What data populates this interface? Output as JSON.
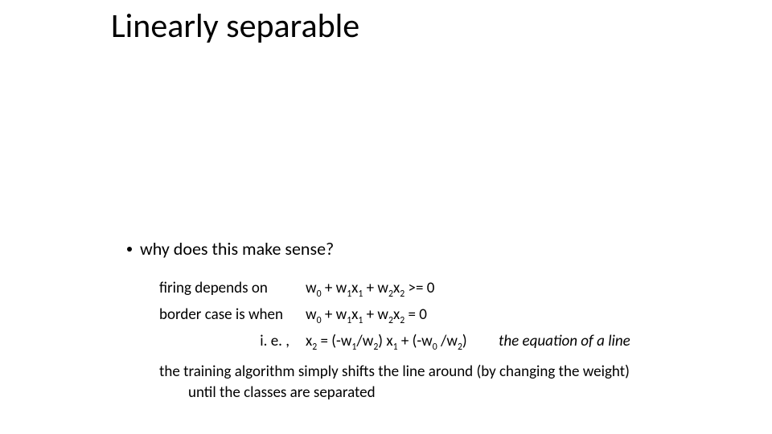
{
  "title": "Linearly separable",
  "bullet": "why does this make sense?",
  "rows": {
    "r1c1": "firing depends on",
    "r1c2": "w<sub>0</sub> + w<sub>1</sub>x<sub>1</sub> + w<sub>2</sub>x<sub>2</sub> >= 0",
    "r2c1": "border case is when",
    "r2c2": "w<sub>0</sub> + w<sub>1</sub>x<sub>1</sub> + w<sub>2</sub>x<sub>2</sub> = 0",
    "r3c1": "i. e. ,",
    "r3c2": "x<sub>2</sub> = (-w<sub>1</sub>/w<sub>2</sub>) x<sub>1</sub> + (-w<sub>0</sub> /w<sub>2</sub>)",
    "r3c3": "the equation of a line"
  },
  "conclusion": "the training algorithm simply shifts the line around (by changing the weight) until the classes are separated"
}
